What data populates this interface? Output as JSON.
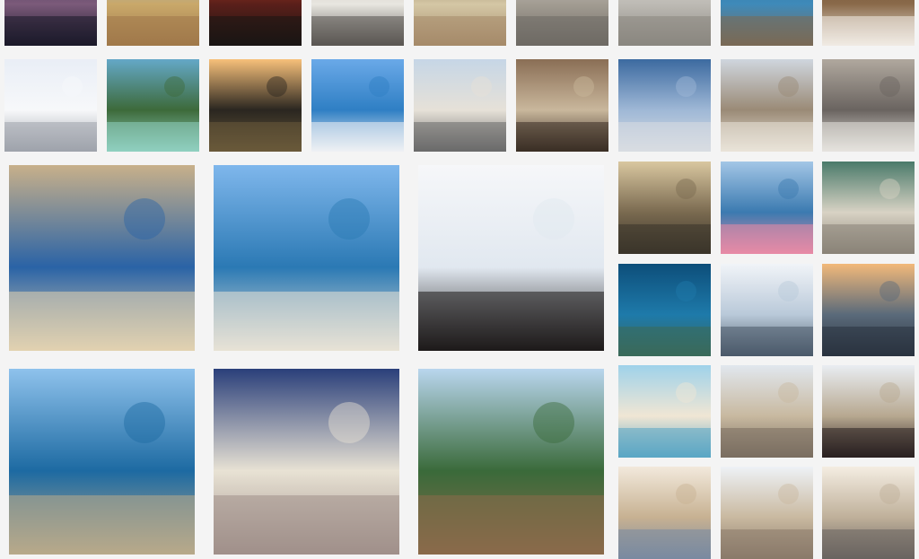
{
  "grid": {
    "label": "",
    "tiles": [
      {
        "id": "sunset-sea-dusk",
        "colors": [
          "#2c2a4a",
          "#7b5a7a",
          "#1b1a2a"
        ]
      },
      {
        "id": "wheat-field-hand",
        "colors": [
          "#7fb6e6",
          "#c9a86a",
          "#a0794a"
        ]
      },
      {
        "id": "red-sunset-horizon",
        "colors": [
          "#f0502a",
          "#5a1f1a",
          "#1a1614"
        ]
      },
      {
        "id": "scooter-street",
        "colors": [
          "#b9b3aa",
          "#e8e6e0",
          "#5a5652"
        ]
      },
      {
        "id": "food-table-top",
        "colors": [
          "#6b4a32",
          "#d4c7a5",
          "#a58a6a"
        ]
      },
      {
        "id": "cathedral-square",
        "colors": [
          "#d7d7d7",
          "#a29c92",
          "#6e6a64"
        ]
      },
      {
        "id": "plaza-crowd",
        "colors": [
          "#e2e2e2",
          "#bdbab4",
          "#8a8780"
        ]
      },
      {
        "id": "coast-cliff-aerial",
        "colors": [
          "#1f6a9a",
          "#3f8ab9",
          "#7a6a55"
        ]
      },
      {
        "id": "cafe-table-top",
        "colors": [
          "#5a3a22",
          "#8a6a4a",
          "#f0ebe4"
        ]
      },
      {
        "id": "milan-duomo",
        "colors": [
          "#e9eef6",
          "#f7f8fa",
          "#9ea3ab"
        ]
      },
      {
        "id": "mountain-river",
        "colors": [
          "#64a8c7",
          "#3d6a3a",
          "#8fcfc0"
        ]
      },
      {
        "id": "sunset-cyclist",
        "colors": [
          "#f7c07a",
          "#2a2620",
          "#6a5a3a"
        ]
      },
      {
        "id": "harbour-blue",
        "colors": [
          "#6aa9e8",
          "#2f7fc4",
          "#eef1f4"
        ]
      },
      {
        "id": "palazzo-facade",
        "colors": [
          "#c6d6e6",
          "#e6e1d8",
          "#6a6a6a"
        ]
      },
      {
        "id": "narrow-alley",
        "colors": [
          "#8a6e55",
          "#c9b79c",
          "#3a2e24"
        ]
      },
      {
        "id": "glass-building",
        "colors": [
          "#3c6aa0",
          "#9fb8d6",
          "#d9dde2"
        ]
      },
      {
        "id": "galleria-square",
        "colors": [
          "#cfd6de",
          "#9a8a76",
          "#e9e3d8"
        ]
      },
      {
        "id": "bicycle-street",
        "colors": [
          "#b0a89e",
          "#6a6460",
          "#e6e3de"
        ]
      },
      {
        "id": "stone-wall-balcony",
        "colors": [
          "#c8b08a",
          "#2a63a6",
          "#e2d2b0"
        ]
      },
      {
        "id": "cliff-town-sea",
        "colors": [
          "#7fb7ec",
          "#2b79b4",
          "#e7e2d6"
        ]
      },
      {
        "id": "portrait-woman",
        "colors": [
          "#f6f7f9",
          "#e1e8f0",
          "#1d1a1a"
        ]
      },
      {
        "id": "alley-laundry",
        "colors": [
          "#d9c7a0",
          "#7a6a50",
          "#3a342a"
        ]
      },
      {
        "id": "island-flowers",
        "colors": [
          "#a3c6e6",
          "#3b7ab0",
          "#e88aa6"
        ]
      },
      {
        "id": "spiral-staircase",
        "colors": [
          "#4a7a6a",
          "#d8d2c4",
          "#8a8478"
        ]
      },
      {
        "id": "underwater-rocks",
        "colors": [
          "#0d4e7a",
          "#1e7aaa",
          "#3a6a5a"
        ]
      },
      {
        "id": "clouds-volcano",
        "colors": [
          "#f1f4f8",
          "#b9c9d9",
          "#4a5a6a"
        ]
      },
      {
        "id": "sunset-boats",
        "colors": [
          "#f2b97a",
          "#5a6a7a",
          "#2a3340"
        ]
      },
      {
        "id": "harbour-boats-town",
        "colors": [
          "#8fc2ec",
          "#1d6aa2",
          "#b8a98a"
        ]
      },
      {
        "id": "arched-gate-blue",
        "colors": [
          "#2a3f7a",
          "#e8e2d4",
          "#a0908a"
        ]
      },
      {
        "id": "rock-island-bay",
        "colors": [
          "#b9d6ee",
          "#3a6a3a",
          "#8a6a4a"
        ]
      },
      {
        "id": "beach-walker",
        "colors": [
          "#9fd2ea",
          "#f0e6d4",
          "#5aa6c4"
        ]
      },
      {
        "id": "parisian-corner",
        "colors": [
          "#e1e7ee",
          "#c8b9a0",
          "#7a6e60"
        ]
      },
      {
        "id": "woman-balcony-city",
        "colors": [
          "#e9edf2",
          "#b7a890",
          "#2a2020"
        ]
      },
      {
        "id": "colorful-street",
        "colors": [
          "#f2e9dc",
          "#c7b192",
          "#7a8aa0"
        ]
      },
      {
        "id": "hill-town-view",
        "colors": [
          "#eef2f6",
          "#c9b9a0",
          "#8a7a6a"
        ]
      },
      {
        "id": "trulli-roofs",
        "colors": [
          "#f4ede2",
          "#bfb09a",
          "#6a6460"
        ]
      }
    ]
  }
}
